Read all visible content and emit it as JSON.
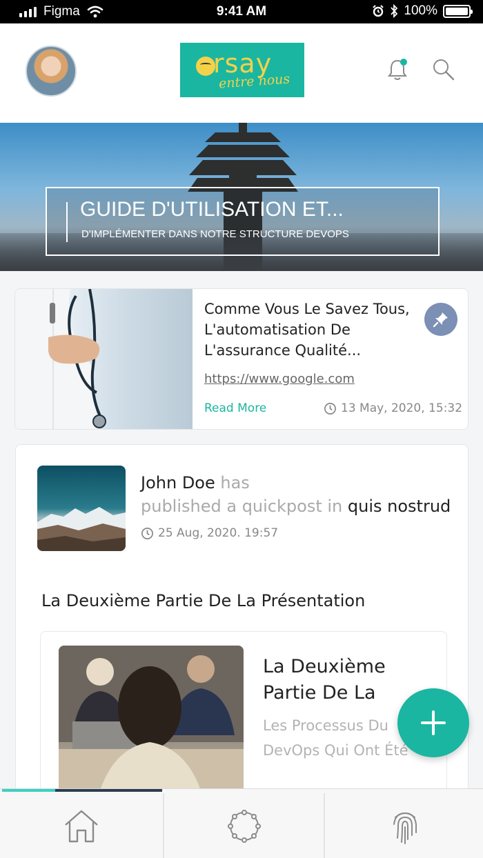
{
  "status_bar": {
    "carrier": "Figma",
    "time": "9:41 AM",
    "battery": "100%"
  },
  "header": {
    "logo_brand": "rsay",
    "logo_tagline": "entre nous",
    "notification_dot_color": "#1ab6a1"
  },
  "banner": {
    "title": "GUIDE D'UTILISATION ET...",
    "subtitle": "D'IMPLÉMENTER DANS NOTRE STRUCTURE DEVOPS"
  },
  "article": {
    "title": "Comme Vous Le Savez Tous, L'automatisation De L'assurance Qualité...",
    "link": "https://www.google.com",
    "read_more": "Read More",
    "date": "13 May, 2020, 15:32",
    "pin_icon": "pin-icon"
  },
  "post": {
    "author": "John Doe",
    "action_has": "has",
    "action_published": "published a quickpost in",
    "target": "quis nostrud",
    "date": "25 Aug, 2020. 19:57",
    "heading": "La Deuxième Partie De La Présentation",
    "inner_title": "La Deuxième Partie De La",
    "inner_desc_line1": "Les Processus Du",
    "inner_desc_line2": "DevOps Qui Ont Été"
  },
  "nav": {
    "items": [
      "home-icon",
      "circle-nodes-icon",
      "fingerprint-icon"
    ]
  },
  "colors": {
    "accent": "#1ab6a1",
    "pin": "#7c8fb5",
    "nav_progress": [
      "#3ad1c1",
      "#2d3d4f",
      "#2d3d4f"
    ]
  }
}
